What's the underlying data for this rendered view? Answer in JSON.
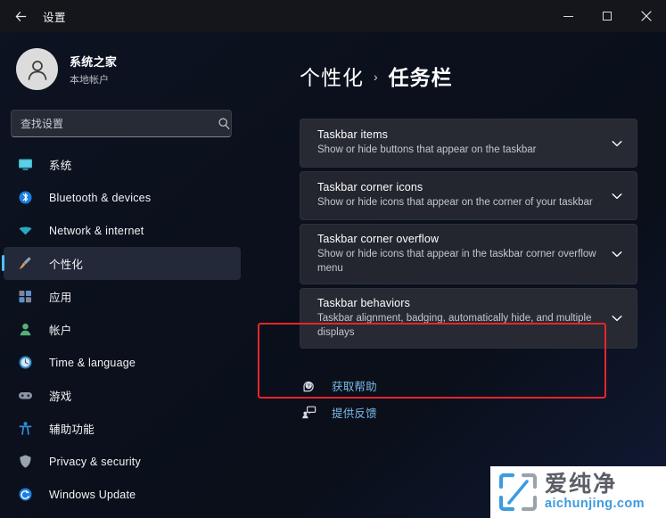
{
  "window": {
    "title": "设置",
    "back_icon": "back-arrow-icon",
    "controls": {
      "minimize": "minimize-icon",
      "maximize": "maximize-icon",
      "close": "close-icon"
    }
  },
  "sidebar": {
    "account": {
      "name": "系统之家",
      "subtitle": "本地帐户",
      "avatar_icon": "person-avatar-icon"
    },
    "search": {
      "placeholder": "查找设置",
      "value": "",
      "icon": "search-icon"
    },
    "items": [
      {
        "label": "系统",
        "icon": "monitor-icon",
        "color": "#3fb8d4",
        "selected": false
      },
      {
        "label": "Bluetooth & devices",
        "icon": "bluetooth-icon",
        "color": "#1a7fe0",
        "selected": false
      },
      {
        "label": "Network & internet",
        "icon": "wifi-icon",
        "color": "#2aa8bf",
        "selected": false
      },
      {
        "label": "个性化",
        "icon": "paintbrush-icon",
        "color": "#d8a05a",
        "selected": true
      },
      {
        "label": "应用",
        "icon": "apps-icon",
        "color": "#7c8696",
        "selected": false
      },
      {
        "label": "帐户",
        "icon": "accounts-icon",
        "color": "#53b07a",
        "selected": false
      },
      {
        "label": "Time & language",
        "icon": "clock-icon",
        "color": "#2f88c8",
        "selected": false
      },
      {
        "label": "游戏",
        "icon": "gamepad-icon",
        "color": "#8d96a6",
        "selected": false
      },
      {
        "label": "辅助功能",
        "icon": "accessibility-icon",
        "color": "#2f8fd8",
        "selected": false
      },
      {
        "label": "Privacy & security",
        "icon": "shield-icon",
        "color": "#9aa3b0",
        "selected": false
      },
      {
        "label": "Windows Update",
        "icon": "update-icon",
        "color": "#1a7fe0",
        "selected": false
      }
    ]
  },
  "main": {
    "breadcrumb": {
      "parent": "个性化",
      "separator": "›",
      "current": "任务栏"
    },
    "cards": [
      {
        "title": "Taskbar items",
        "desc": "Show or hide buttons that appear on the taskbar",
        "chevron": "chevron-down-icon",
        "highlighted": false
      },
      {
        "title": "Taskbar corner icons",
        "desc": "Show or hide icons that appear on the corner of your taskbar",
        "chevron": "chevron-down-icon",
        "highlighted": false
      },
      {
        "title": "Taskbar corner overflow",
        "desc": "Show or hide icons that appear in the taskbar corner overflow menu",
        "chevron": "chevron-down-icon",
        "highlighted": false
      },
      {
        "title": "Taskbar behaviors",
        "desc": "Taskbar alignment, badging, automatically hide, and multiple displays",
        "chevron": "chevron-down-icon",
        "highlighted": true
      }
    ],
    "links": [
      {
        "label": "获取帮助",
        "icon": "help-question-icon"
      },
      {
        "label": "提供反馈",
        "icon": "feedback-icon"
      }
    ]
  },
  "annotation": {
    "highlight_color": "#e8252c",
    "target": "Taskbar behaviors"
  },
  "watermark": {
    "logo_icon": "bracket-slash-logo-icon",
    "text_cn": "爱纯净",
    "text_en": "aichunjing.com",
    "accent_color": "#3d9be0"
  }
}
